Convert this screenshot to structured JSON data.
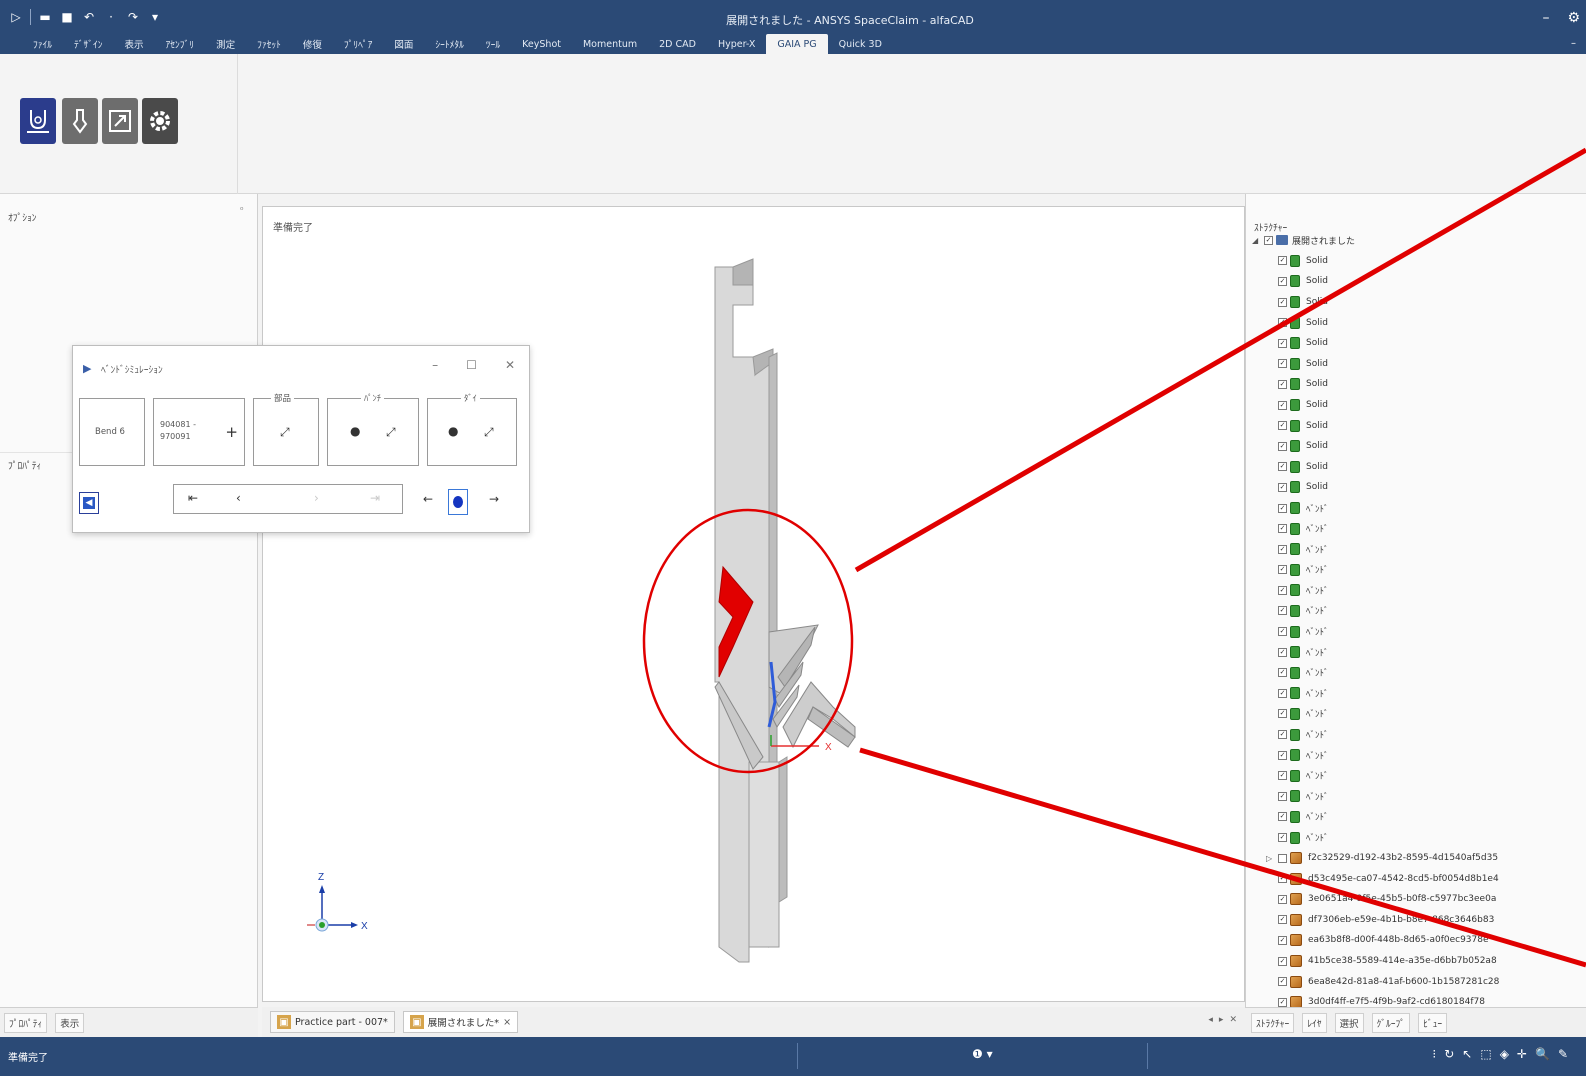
{
  "app": {
    "window_title": "展開されました - ANSYS SpaceClaim - alfaCAD"
  },
  "ribbon_tabs": [
    {
      "label": "ﾌｧｲﾙ",
      "active": false
    },
    {
      "label": "ﾃﾞｻﾞｲﾝ",
      "active": false
    },
    {
      "label": "表示",
      "active": false
    },
    {
      "label": "ｱｾﾝﾌﾞﾘ",
      "active": false
    },
    {
      "label": "測定",
      "active": false
    },
    {
      "label": "ﾌｧｾｯﾄ",
      "active": false
    },
    {
      "label": "修復",
      "active": false
    },
    {
      "label": "ﾌﾟﾘﾍﾟｱ",
      "active": false
    },
    {
      "label": "図面",
      "active": false
    },
    {
      "label": "ｼｰﾄﾒﾀﾙ",
      "active": false
    },
    {
      "label": "ﾂｰﾙ",
      "active": false
    },
    {
      "label": "KeyShot",
      "active": false
    },
    {
      "label": "Momentum",
      "active": false
    },
    {
      "label": "2D CAD",
      "active": false
    },
    {
      "label": "Hyper-X",
      "active": false
    },
    {
      "label": "GAIA PG",
      "active": true
    },
    {
      "label": "Quick 3D",
      "active": false
    }
  ],
  "left_panel": {
    "options_label": "ｵﾌﾟｼｮﾝ",
    "properties_label": "ﾌﾟﾛﾊﾟﾃｨ",
    "tabs": [
      "ﾌﾟﾛﾊﾟﾃｨ",
      "表示"
    ]
  },
  "viewport": {
    "status": "準備完了",
    "axis_triad": {
      "z": "Z",
      "x": "X"
    },
    "model_axis_label": "X"
  },
  "dialog": {
    "title": "ﾍﾞﾝﾄﾞｼﾐｭﾚｰｼｮﾝ",
    "bend_label": "Bend 6",
    "part_line1": "904081 -",
    "part_line2": "970091",
    "group_part": "部品",
    "group_punch": "ﾊﾟﾝﾁ",
    "group_die": "ﾀﾞｲ"
  },
  "document_tabs": [
    {
      "label": "Practice part - 007*",
      "active": false
    },
    {
      "label": "展開されました*",
      "active": true
    }
  ],
  "structure": {
    "header": "ｽﾄﾗｸﾁｬｰ",
    "root": "展開されました",
    "solids": [
      "Solid",
      "Solid",
      "Solid",
      "Solid",
      "Solid",
      "Solid",
      "Solid",
      "Solid",
      "Solid",
      "Solid",
      "Solid",
      "Solid"
    ],
    "bends": [
      "ﾍﾞﾝﾄﾞ",
      "ﾍﾞﾝﾄﾞ",
      "ﾍﾞﾝﾄﾞ",
      "ﾍﾞﾝﾄﾞ",
      "ﾍﾞﾝﾄﾞ",
      "ﾍﾞﾝﾄﾞ",
      "ﾍﾞﾝﾄﾞ",
      "ﾍﾞﾝﾄﾞ",
      "ﾍﾞﾝﾄﾞ",
      "ﾍﾞﾝﾄﾞ",
      "ﾍﾞﾝﾄﾞ",
      "ﾍﾞﾝﾄﾞ",
      "ﾍﾞﾝﾄﾞ",
      "ﾍﾞﾝﾄﾞ",
      "ﾍﾞﾝﾄﾞ",
      "ﾍﾞﾝﾄﾞ",
      "ﾍﾞﾝﾄﾞ"
    ],
    "components": [
      {
        "label": "f2c32529-d192-43b2-8595-4d1540af5d35",
        "checked": false,
        "expander": true
      },
      {
        "label": "d53c495e-ca07-4542-8cd5-bf0054d8b1e4",
        "checked": true,
        "expander": false
      },
      {
        "label": "3e0651a4-9f5e-45b5-b0f8-c5977bc3ee0a",
        "checked": true,
        "expander": false
      },
      {
        "label": "df7306eb-e59e-4b1b-b8e7-868c3646b83",
        "checked": true,
        "expander": false
      },
      {
        "label": "ea63b8f8-d00f-448b-8d65-a0f0ec9378e",
        "checked": true,
        "expander": false
      },
      {
        "label": "41b5ce38-5589-414e-a35e-d6bb7b052a8",
        "checked": true,
        "expander": false
      },
      {
        "label": "6ea8e42d-81a8-41af-b600-1b1587281c28",
        "checked": true,
        "expander": false
      },
      {
        "label": "3d0df4ff-e7f5-4f9b-9af2-cd6180184f78",
        "checked": true,
        "expander": false
      }
    ],
    "bottom_tabs": [
      "ｽﾄﾗｸﾁｬｰ",
      "ﾚｲﾔ",
      "選択",
      "ｸﾞﾙｰﾌﾟ",
      "ﾋﾞｭｰ"
    ]
  },
  "statusbar": {
    "text": "準備完了"
  },
  "colors": {
    "title_bar": "#2b4a76",
    "annotation": "#e00000",
    "body_green": "#3c9a3c",
    "component_orange": "#d08a36"
  }
}
